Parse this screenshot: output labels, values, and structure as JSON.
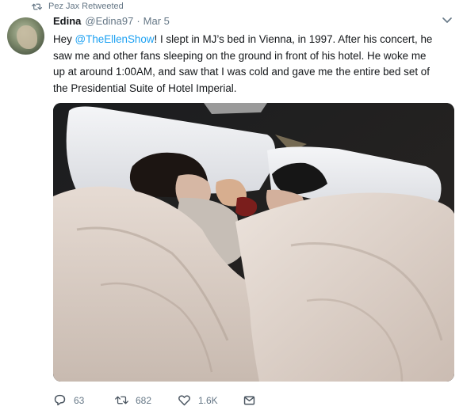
{
  "retweet": {
    "label": "Pez Jax Retweeted"
  },
  "tweet": {
    "author_name": "Edina",
    "handle": "@Edina97",
    "separator": "·",
    "date": "Mar 5",
    "lines": {
      "l1_start": "Hey ",
      "l1_mention": "@TheEllenShow",
      "l1_end": "! I slept in MJ’s bed in Vienna, in 1997. After his concert, he",
      "l2": "saw me and other fans sleeping on the ground in front of his hotel. He woke me",
      "l3": "up at around 1:00AM, and saw that I was cold and gave me the entire bed set of",
      "l4": "the Presidential Suite of Hotel Imperial."
    }
  },
  "actions": {
    "replies": "63",
    "retweets": "682",
    "likes": "1.6K"
  },
  "icons": {
    "retweet_small": "retweet-icon",
    "caret": "chevron-down-icon",
    "reply": "reply-icon",
    "retweet": "retweet-icon",
    "like": "heart-icon",
    "dm": "envelope-icon"
  },
  "colors": {
    "accent": "#1da1f2",
    "muted": "#657786",
    "text": "#14171a"
  }
}
